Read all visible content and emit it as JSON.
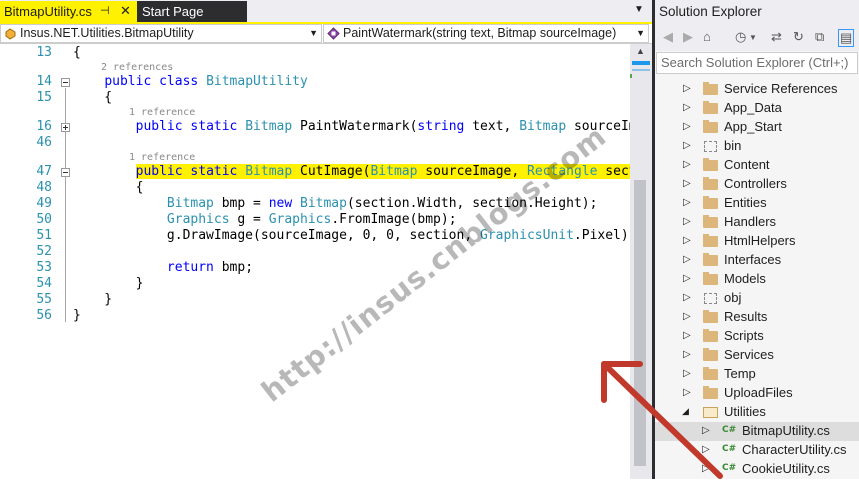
{
  "tabs": {
    "active": {
      "title": "BitmapUtility.cs",
      "pin": "⊣",
      "close": "✕"
    },
    "inactive": {
      "title": "Start Page"
    },
    "dropdown": "▼"
  },
  "navbar": {
    "class_selector": "Insus.NET.Utilities.BitmapUtility",
    "member_selector": "PaintWatermark(string text, Bitmap sourceImage)"
  },
  "code": {
    "line_numbers": [
      "13",
      "14",
      "15",
      "16",
      "46",
      "47",
      "48",
      "49",
      "50",
      "51",
      "52",
      "53",
      "54",
      "55",
      "56"
    ],
    "references": {
      "class_refs": "2 references",
      "paint_refs": "1 reference",
      "cut_refs": "1 reference"
    },
    "collapsed_hint": "..."
  },
  "solution_explorer": {
    "title": "Solution Explorer",
    "search_placeholder": "Search Solution Explorer (Ctrl+;)",
    "folders": [
      {
        "label": "Service References",
        "kind": "folder"
      },
      {
        "label": "App_Data",
        "kind": "folder"
      },
      {
        "label": "App_Start",
        "kind": "folder"
      },
      {
        "label": "bin",
        "kind": "dashed"
      },
      {
        "label": "Content",
        "kind": "folder"
      },
      {
        "label": "Controllers",
        "kind": "folder"
      },
      {
        "label": "Entities",
        "kind": "folder"
      },
      {
        "label": "Handlers",
        "kind": "folder"
      },
      {
        "label": "HtmlHelpers",
        "kind": "folder"
      },
      {
        "label": "Interfaces",
        "kind": "folder"
      },
      {
        "label": "Models",
        "kind": "folder"
      },
      {
        "label": "obj",
        "kind": "dashed"
      },
      {
        "label": "Results",
        "kind": "folder"
      },
      {
        "label": "Scripts",
        "kind": "folder"
      },
      {
        "label": "Services",
        "kind": "folder"
      },
      {
        "label": "Temp",
        "kind": "folder"
      },
      {
        "label": "UploadFiles",
        "kind": "folder"
      },
      {
        "label": "Utilities",
        "kind": "open"
      }
    ],
    "files": [
      {
        "label": "BitmapUtility.cs",
        "selected": true
      },
      {
        "label": "CharacterUtility.cs",
        "selected": false
      },
      {
        "label": "CookieUtility.cs",
        "selected": false
      }
    ]
  },
  "watermark": "http://insus.cnblogs.com",
  "colors": {
    "highlight": "#fff100",
    "keyword": "#0000ff",
    "type": "#2b91af",
    "arrow": "#c0392b"
  }
}
